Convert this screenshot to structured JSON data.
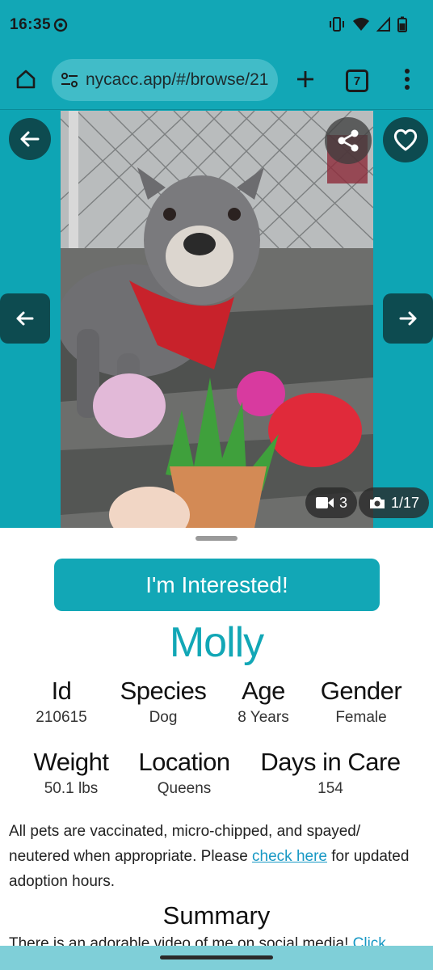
{
  "status_bar": {
    "time": "16:35",
    "icons": [
      "chrome-status-icon",
      "vibrate-icon",
      "wifi-icon",
      "signal-icon",
      "battery-icon"
    ]
  },
  "browser": {
    "url": "nycacc.app/#/browse/21",
    "tab_count": "7",
    "icons": [
      "home-icon",
      "site-settings-icon",
      "new-tab-plus-icon",
      "tabs-icon",
      "more-menu-icon"
    ]
  },
  "gallery": {
    "video_count": "3",
    "photo_position": "1/17",
    "icons": [
      "back-arrow-icon",
      "heart-icon",
      "share-icon",
      "prev-arrow-icon",
      "next-arrow-icon",
      "video-camera-icon",
      "camera-icon"
    ]
  },
  "pet": {
    "interest_button": "I'm Interested!",
    "name": "Molly",
    "facts_row1": [
      {
        "label": "Id",
        "value": "210615"
      },
      {
        "label": "Species",
        "value": "Dog"
      },
      {
        "label": "Age",
        "value": "8 Years"
      },
      {
        "label": "Gender",
        "value": "Female"
      }
    ],
    "facts_row2": [
      {
        "label": "Weight",
        "value": "50.1 lbs"
      },
      {
        "label": "Location",
        "value": "Queens"
      },
      {
        "label": "Days in Care",
        "value": "154"
      }
    ],
    "notice": {
      "before": "All pets are vaccinated, micro-chipped, and spayed/ neutered when appropriate. Please ",
      "link": "check here",
      "after": " for updated adoption hours."
    },
    "summary_title": "Summary",
    "summary_text": "There is an adorable video of me on social media! ",
    "summary_link": "Click"
  },
  "colors": {
    "brand_teal": "#12a7b6",
    "dark_button": "#0d4b50",
    "link_blue": "#1798c4"
  }
}
